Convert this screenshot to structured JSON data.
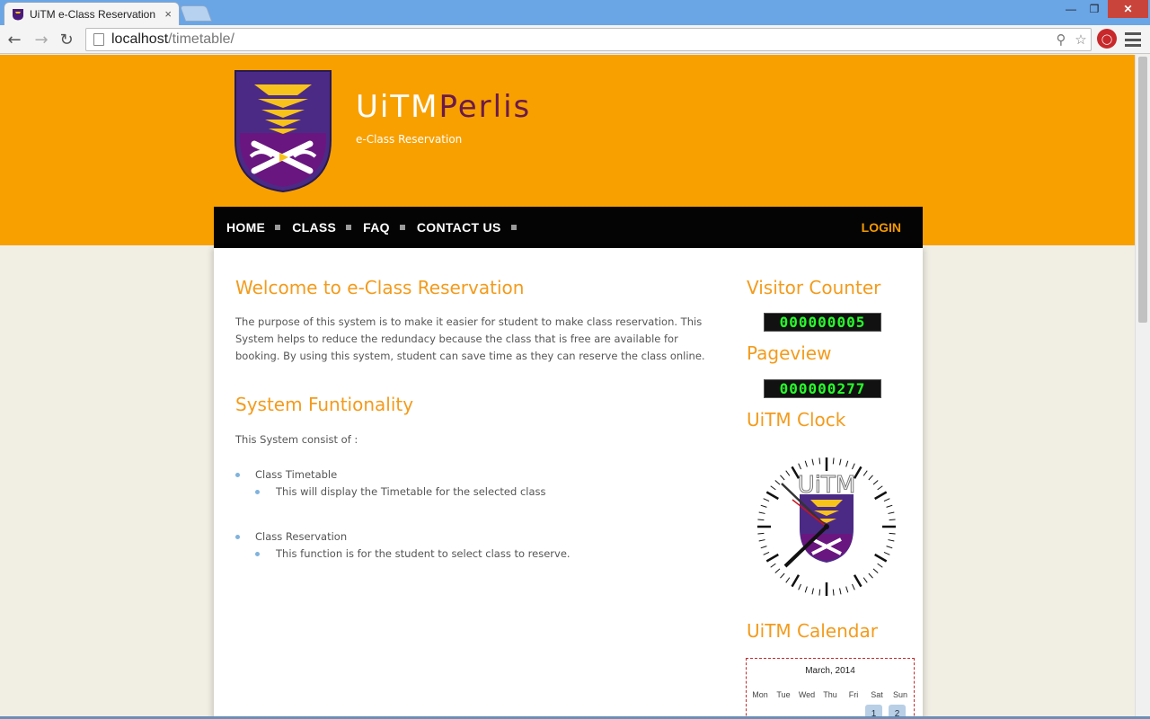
{
  "browser": {
    "tab_title": "UiTM e-Class Reservation",
    "tab_close": "×",
    "url_host": "localhost",
    "url_path": "/timetable/",
    "icons": [
      "back-icon",
      "forward-icon",
      "reload-icon",
      "page-icon",
      "search-icon",
      "star-icon",
      "extension-icon",
      "menu-icon"
    ]
  },
  "header": {
    "title_part1": "UiTM",
    "title_part2": "Perlis",
    "subtitle": "e-Class Reservation",
    "colors": {
      "band": "#f8a000",
      "accent": "#6b1a4a"
    }
  },
  "nav": {
    "items": [
      {
        "label": "HOME"
      },
      {
        "label": "CLASS"
      },
      {
        "label": "FAQ"
      },
      {
        "label": "CONTACT US"
      }
    ],
    "login": "LOGIN"
  },
  "main": {
    "welcome_title": "Welcome to e-Class Reservation",
    "intro": "The purpose of this system is to make it easier for student to make class reservation. This System helps to reduce the redundacy because the class that is free are available for booking. By using this system, student can save time as they can reserve the class online.",
    "func_title": "System Funtionality",
    "consist": "This System consist of :",
    "functions": [
      {
        "name": "Class Timetable",
        "desc": "This will display the Timetable for the selected class"
      },
      {
        "name": "Class Reservation",
        "desc": "This function is for the student to select class to reserve."
      }
    ]
  },
  "sidebar": {
    "visitor_title": "Visitor Counter",
    "visitor_count": "000000005",
    "pageview_title": "Pageview",
    "pageview_count": "000000277",
    "clock_title": "UiTM Clock",
    "clock_brand": "UiTM",
    "calendar_title": "UiTM Calendar",
    "calendar": {
      "month": "March, 2014",
      "days": [
        "Mon",
        "Tue",
        "Wed",
        "Thu",
        "Fri",
        "Sat",
        "Sun"
      ],
      "first_row": [
        "1",
        "2"
      ]
    }
  }
}
